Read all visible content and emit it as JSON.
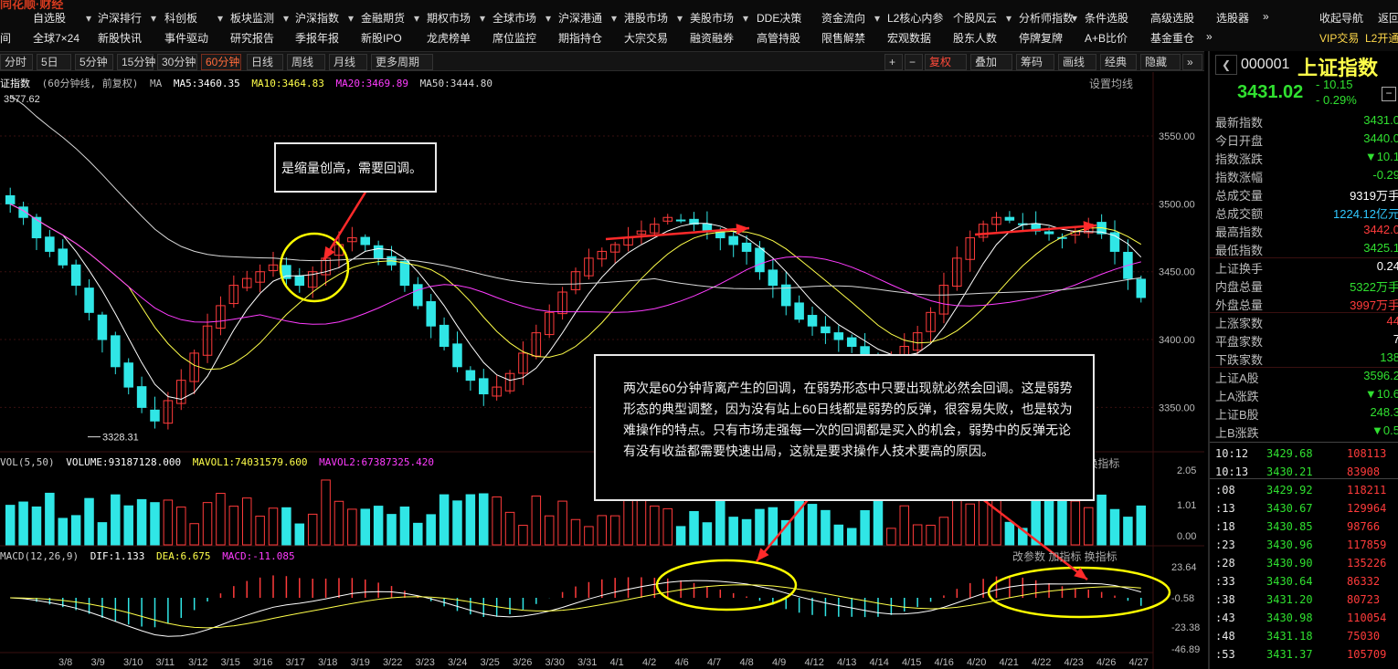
{
  "colors": {
    "up": "#ff3b3b",
    "down": "#30e6e6",
    "ma5": "#ffffff",
    "ma10": "#ffff4a",
    "ma20": "#ff3cff",
    "ma50": "#d8d8d8",
    "accent": "#ff6a3a",
    "annotation_yellow": "#ffff00",
    "annotation_red": "#ff2a2a"
  },
  "top_menu": {
    "row1": [
      "自选股",
      "沪深排行",
      "科创板",
      "板块监测",
      "沪深指数",
      "金融期货",
      "期权市场",
      "全球市场",
      "沪深港通",
      "港股市场",
      "美股市场",
      "DDE决策",
      "资金流向",
      "L2核心内参",
      "个股风云",
      "分析师指数",
      "条件选股",
      "高级选股",
      "选股器",
      "»",
      "收起导航",
      "返回"
    ],
    "row2": [
      "全球7×24",
      "新股快讯",
      "事件驱动",
      "研究报告",
      "季报年报",
      "新股IPO",
      "龙虎榜单",
      "席位监控",
      "期指持仓",
      "大宗交易",
      "融资融券",
      "高管持股",
      "限售解禁",
      "宏观数据",
      "股东人数",
      "停牌复牌",
      "A+B比价",
      "基金重仓",
      "»",
      "VIP交易",
      "L2开通"
    ],
    "row2_left": "间"
  },
  "toolbar": {
    "periods": [
      "分时",
      "5日",
      "5分钟",
      "15分钟",
      "30分钟",
      "60分钟",
      "日线",
      "周线",
      "月线",
      "更多周期"
    ],
    "active_period": "60分钟",
    "right": [
      "+",
      "−",
      "复权",
      "叠加",
      "筹码",
      "画线",
      "经典",
      "隐藏"
    ]
  },
  "chart_header": {
    "title": "证指数",
    "subtitle": "(60分钟线, 前复权)",
    "ma_label": "MA",
    "ma5": "MA5:3460.35",
    "ma10": "MA10:3464.83",
    "ma20": "MA20:3469.89",
    "ma50": "MA50:3444.80",
    "settings": "设置均线"
  },
  "price_axis": {
    "ticks": [
      "3550.00",
      "3500.00",
      "3450.00",
      "3400.00",
      "3350.00"
    ],
    "high_mark": "3577.62",
    "low_mark": "3328.31"
  },
  "volume": {
    "label": "VOL(5,50)",
    "volume": "VOLUME:93187128.000",
    "mavol1": "MAVOL1:74031579.600",
    "mavol2": "MAVOL2:67387325.420",
    "axis": [
      "2.05",
      "1.01",
      "0.00"
    ],
    "right_links": "加指标 换指标"
  },
  "macd": {
    "label": "MACD(12,26,9)",
    "dif": "DIF:1.133",
    "dea": "DEA:6.675",
    "macd": "MACD:-11.085",
    "axis": [
      "23.64",
      "-0.58",
      "-23.38",
      "-46.89"
    ],
    "right_links": "改参数 加指标 换指标"
  },
  "date_axis": [
    "3/8",
    "3/9",
    "3/10",
    "3/11",
    "3/12",
    "3/15",
    "3/16",
    "3/17",
    "3/18",
    "3/19",
    "3/22",
    "3/23",
    "3/24",
    "3/25",
    "3/26",
    "3/30",
    "3/31",
    "4/1",
    "4/2",
    "4/6",
    "4/7",
    "4/8",
    "4/9",
    "4/12",
    "4/13",
    "4/14",
    "4/15",
    "4/16",
    "4/20",
    "4/21",
    "4/22",
    "4/23",
    "4/26",
    "4/27"
  ],
  "annotations": {
    "top_note": "是缩量创高，需要回调。",
    "main_note": "两次是60分钟背离产生的回调，在弱势形态中只要出现就必然会回调。这是弱势形态的典型调整，因为没有站上60日线都是弱势的反弹，很容易失败，也是较为难操作的特点。只有市场走强每一次的回调都是买入的机会，弱势中的反弹无论有没有收益都需要快速出局，这就是要求操作人技术要高的原因。"
  },
  "quote": {
    "code": "000001",
    "name": "上证指数",
    "price": "3431.02",
    "change": "- 10.15",
    "change_pct": "- 0.29%",
    "stats": [
      {
        "k": "最新指数",
        "v": "3431.0",
        "c": "#30e030"
      },
      {
        "k": "今日开盘",
        "v": "3440.0",
        "c": "#30e030"
      },
      {
        "k": "指数涨跌",
        "v": "▼10.1",
        "c": "#30e030"
      },
      {
        "k": "指数涨幅",
        "v": "-0.29",
        "c": "#30e030"
      },
      {
        "k": "总成交量",
        "v": "9319万手",
        "c": "#ffffff"
      },
      {
        "k": "总成交额",
        "v": "1224.12亿元",
        "c": "#30c8ff"
      },
      {
        "k": "最高指数",
        "v": "3442.0",
        "c": "#ff3b3b"
      },
      {
        "k": "最低指数",
        "v": "3425.1",
        "c": "#30e030"
      },
      {
        "k": "上证换手",
        "v": "0.24",
        "c": "#ffffff"
      },
      {
        "k": "内盘总量",
        "v": "5322万手",
        "c": "#30e030"
      },
      {
        "k": "外盘总量",
        "v": "3997万手",
        "c": "#ff3b3b"
      },
      {
        "k": "上涨家数",
        "v": "44",
        "c": "#ff3b3b"
      },
      {
        "k": "平盘家数",
        "v": "7",
        "c": "#ffffff"
      },
      {
        "k": "下跌家数",
        "v": "138",
        "c": "#30e030"
      },
      {
        "k": "上证A股",
        "v": "3596.2",
        "c": "#30e030"
      },
      {
        "k": "上A涨跌",
        "v": "▼10.6",
        "c": "#30e030"
      },
      {
        "k": "上证B股",
        "v": "248.3",
        "c": "#30e030"
      },
      {
        "k": "上B涨跌",
        "v": "▼0.5",
        "c": "#30e030"
      }
    ],
    "ticks": [
      {
        "t": "10:12",
        "p": "3429.68",
        "v": "108113"
      },
      {
        "t": "10:13",
        "p": "3430.21",
        "v": "83908"
      },
      {
        "t": ":08",
        "p": "3429.92",
        "v": "118211"
      },
      {
        "t": ":13",
        "p": "3430.67",
        "v": "129964"
      },
      {
        "t": ":18",
        "p": "3430.85",
        "v": "98766"
      },
      {
        "t": ":23",
        "p": "3430.96",
        "v": "117859"
      },
      {
        "t": ":28",
        "p": "3430.90",
        "v": "135226"
      },
      {
        "t": ":33",
        "p": "3430.64",
        "v": "86332"
      },
      {
        "t": ":38",
        "p": "3431.20",
        "v": "80723"
      },
      {
        "t": ":43",
        "p": "3430.98",
        "v": "110054"
      },
      {
        "t": ":48",
        "p": "3431.18",
        "v": "75030"
      },
      {
        "t": ":53",
        "p": "3431.37",
        "v": "105709"
      }
    ]
  },
  "chart_data": {
    "type": "candlestick",
    "ohlc_hourly_close_approx": [
      3500,
      3490,
      3475,
      3465,
      3455,
      3440,
      3420,
      3400,
      3380,
      3365,
      3350,
      3340,
      3355,
      3370,
      3390,
      3410,
      3425,
      3440,
      3445,
      3450,
      3455,
      3445,
      3440,
      3450,
      3460,
      3470,
      3475,
      3470,
      3460,
      3455,
      3440,
      3425,
      3410,
      3395,
      3380,
      3370,
      3360,
      3365,
      3375,
      3390,
      3405,
      3420,
      3435,
      3450,
      3460,
      3465,
      3470,
      3475,
      3480,
      3485,
      3490,
      3488,
      3485,
      3480,
      3475,
      3470,
      3465,
      3450,
      3440,
      3425,
      3415,
      3410,
      3405,
      3400,
      3395,
      3385,
      3380,
      3385,
      3395,
      3405,
      3420,
      3440,
      3460,
      3475,
      3485,
      3490,
      3488,
      3485,
      3480,
      3478,
      3475,
      3480,
      3485,
      3478,
      3465,
      3445,
      3431
    ],
    "ylim": [
      3320,
      3585
    ]
  }
}
